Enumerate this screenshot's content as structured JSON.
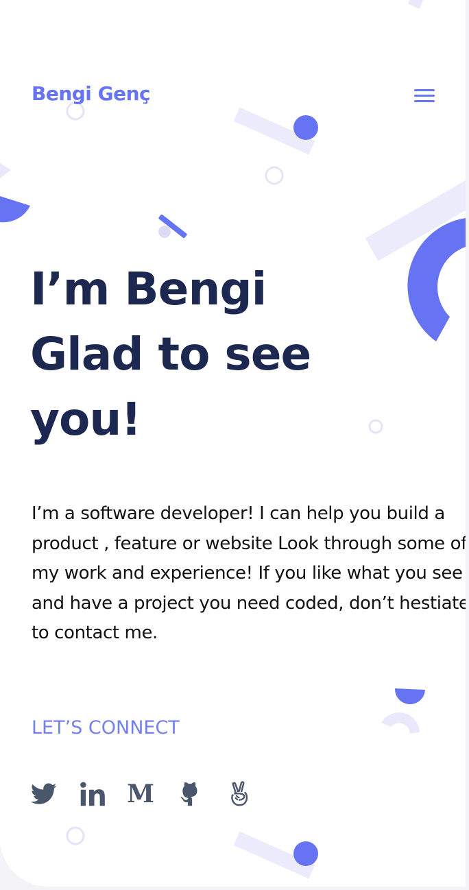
{
  "brand": {
    "name": "Bengi Genç"
  },
  "menu": {
    "icon": "hamburger-icon"
  },
  "hero": {
    "headline_lines": [
      "I’m Bengi",
      "Glad to see",
      "you!"
    ],
    "intro": "I’m a software developer! I can help you build a product , feature or website Look through some of my work and experience! If you like what you see and have a project you need coded, don’t hestiate to contact me."
  },
  "connect": {
    "label": "LET’S CONNECT"
  },
  "socials": [
    {
      "icon": "twitter-icon"
    },
    {
      "icon": "linkedin-icon"
    },
    {
      "icon": "medium-icon",
      "glyph": "M"
    },
    {
      "icon": "github-icon"
    },
    {
      "icon": "angellist-icon"
    }
  ],
  "colors": {
    "accent": "#6673f2",
    "heading": "#1c2850",
    "body_text": "#111111",
    "icon": "#4a566b",
    "decor_light": "#e9e9fb"
  }
}
